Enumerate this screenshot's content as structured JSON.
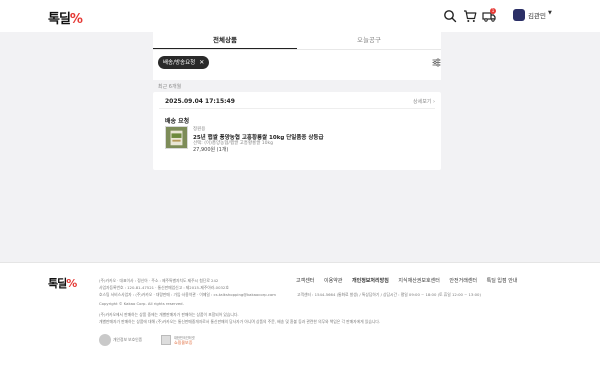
{
  "header": {
    "logo_text": "톡딜",
    "logo_mark": "%",
    "user_name": "김관민",
    "notification_count": "1",
    "icons": [
      "search-icon",
      "cart-icon",
      "delivery-icon"
    ]
  },
  "tabs": [
    {
      "label": "전체상품",
      "active": true
    },
    {
      "label": "오늘공구",
      "active": false
    }
  ],
  "filter": {
    "chip_label": "배송/방송요청",
    "chip_close": "✕"
  },
  "summary": {
    "count_text": "최근 6개월"
  },
  "order": {
    "date": "2025.09.04 17:15:49",
    "detail_link": "상세보기 ›",
    "request_title": "배송 요청",
    "seller": "정원용",
    "product_name": "25년 햅쌀 풍양농협 고흥황룡쌀 10kg 단일품종 상등급",
    "option": "선택: (이)풍양농협/햅쌀 고흥황룡쌀 10kg",
    "price": "27,900원 (1개)"
  },
  "footer": {
    "logo_text": "톡딜",
    "logo_mark": "%",
    "info_lines": [
      "(주)카카오 · 대표이사 : 정신아 · 주소 : 제주특별자치도 제주시 첨단로 242",
      "사업자등록번호 : 120-81-47521 · 통신판매업신고 : 제2015-제주아라-0032호",
      "호스팅 서비스사업자 : (주)카카오 · 대량판매 : 가입·사용약관 · 이메일 : cs.talkshopping@kakaocorp.com",
      "Copyright © Kakao Corp. All rights reserved."
    ],
    "links": [
      "고객센터",
      "이용약관",
      "개인정보처리방침",
      "지식재산권보호센터",
      "안전거래센터",
      "톡딜 입점 안내"
    ],
    "contact_line": "고객센터 : 1544-5664 (통화료 발생) / 톡상담하기 / 상담시간 : 평일 09:00 ~ 18:00 (토 휴일 12:00 ~ 13:00)",
    "notice_lines": [
      "(주)카카오에서 판매하는 상품 중에는 개별판매자가 판매하는 상품이 포함되어 있습니다.",
      "개별판매자가 판매하는 상품에 대해 (주)카카오는 통신판매중개자로서 통신판매의 당사자가 아니며 상품의 주문, 배송 및 환불 등과 관련한 의무와 책임은 각 판매자에게 있습니다."
    ],
    "cert1_text": "개인정보 보호인증",
    "cert2_line1": "대한민국인터넷",
    "cert2_line2": "쇼핑몰보증"
  }
}
